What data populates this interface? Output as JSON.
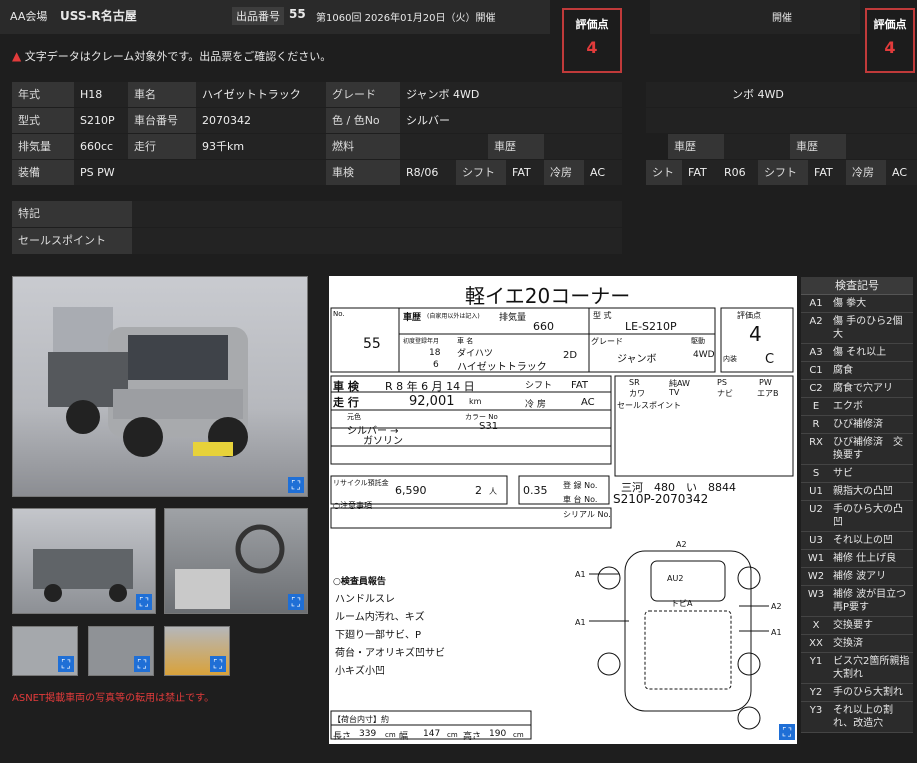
{
  "header": {
    "venue_label": "AA会場",
    "venue": "USS-R名古屋",
    "lot_label": "出品番号",
    "lot": "55",
    "session": "第1060回 2026年01月20日（火）開催",
    "notice": "文字データはクレーム対象外です。出品票をご確認ください。",
    "score_title": "評価点",
    "score": "4",
    "ghost_session": "開催",
    "ghost_score_title": "評価点",
    "ghost_score": "4"
  },
  "specs": {
    "r1": [
      "年式",
      "H18",
      "車名",
      "ハイゼットトラック",
      "グレード",
      "ジャンボ 4WD"
    ],
    "r2": [
      "型式",
      "S210P",
      "車台番号",
      "2070342",
      "色 / 色No",
      "シルバー"
    ],
    "r3": [
      "排気量",
      "660cc",
      "走行",
      "93千km",
      "燃料",
      "",
      "車歴",
      ""
    ],
    "r4": [
      "装備",
      "PS PW",
      "車検",
      "R8/06",
      "シフト",
      "FAT",
      "冷房",
      "AC"
    ],
    "special_label": "特記",
    "sales_label": "セールスポイント",
    "ghost_grade": "ンボ 4WD",
    "ghost_history1": "車歴",
    "ghost_history2": "車歴",
    "ghost_r4": [
      "シト",
      "FAT",
      "R06",
      "シフト",
      "FAT",
      "冷房",
      "AC"
    ]
  },
  "photos": {
    "warning": "ASNET掲載車両の写真等の転用は禁止です。",
    "zoom_icon": "⛶"
  },
  "sheet": {
    "title": "軽イエ20コーナー",
    "no_label": "No.",
    "lot": "55",
    "history_label": "車歴",
    "history_note": "(自家用以外は記入)",
    "displacement_label": "排気量",
    "displacement": "660",
    "model_label": "型 式",
    "model": "LE-S210P",
    "score_label": "評価点",
    "score": "4",
    "first_reg_label": "初度登録年月",
    "year": "18",
    "month": "6",
    "car_name_label": "車 名",
    "maker": "ダイハツ",
    "car_name": "ハイゼットトラック",
    "doors": "2D",
    "grade_label": "グレード",
    "grade": "ジャンボ",
    "drive_label": "駆動",
    "drive": "4WD",
    "interior_label": "内装",
    "interior_score": "C",
    "inspection_label": "車 検",
    "inspection": "R 8 年 6 月 14 日",
    "shift_label": "シフト",
    "shift": "FAT",
    "mileage_label": "走 行",
    "mileage": "92,001",
    "mileage_unit": "km",
    "ac_label": "冷 房",
    "ac": "AC",
    "color_label": "元色",
    "color": "シルバー →",
    "color_no_label": "カラー No",
    "color_no": "S31",
    "fuel": "ガソリン",
    "equip": [
      "SR",
      "純AW",
      "PS",
      "PW",
      "カワ",
      "TV",
      "ナビ",
      "エアB"
    ],
    "sales_point_label": "セールスポイント",
    "recycle_label": "リサイクル預託金",
    "recycle": "6,590",
    "capacity": "2",
    "capacity_unit": "人",
    "load": "0.35",
    "plate_label": "登 録 No.",
    "plate": "三河　480　い　8844",
    "chassis_label": "車 台 No.",
    "chassis": "S210P-2070342",
    "serial_label": "シリアル No.",
    "caution": "○注意事項",
    "inspector_title": "○検査員報告",
    "inspector_notes": [
      "ハンドルスレ",
      "ルーム内汚れ、キズ",
      "下廻り一部サビ、P",
      "荷台・アオリキズ凹サビ",
      "小キズ小凹"
    ],
    "marks": {
      "a2_top": "A2",
      "au2": "AU2",
      "tobia": "トビA",
      "a1_left": "A1",
      "a1_mid": "A1",
      "a2_right": "A2",
      "a1_right": "A1"
    },
    "cargo_label": "【荷台内寸】約",
    "length_label": "長さ",
    "length": "339",
    "width_label": "幅",
    "width": "147",
    "height_label": "高さ",
    "height": "190",
    "unit": "cm"
  },
  "legend": {
    "title": "検査記号",
    "items": [
      {
        "code": "A1",
        "desc": "傷 拳大"
      },
      {
        "code": "A2",
        "desc": "傷 手のひら2個大"
      },
      {
        "code": "A3",
        "desc": "傷 それ以上"
      },
      {
        "code": "C1",
        "desc": "腐食"
      },
      {
        "code": "C2",
        "desc": "腐食で穴アリ"
      },
      {
        "code": "E",
        "desc": "エクボ"
      },
      {
        "code": "R",
        "desc": "ひび補修済"
      },
      {
        "code": "RX",
        "desc": "ひび補修済　交換要す"
      },
      {
        "code": "S",
        "desc": "サビ"
      },
      {
        "code": "U1",
        "desc": "親指大の凸凹"
      },
      {
        "code": "U2",
        "desc": "手のひら大の凸凹"
      },
      {
        "code": "U3",
        "desc": "それ以上の凹"
      },
      {
        "code": "W1",
        "desc": "補修 仕上げ良"
      },
      {
        "code": "W2",
        "desc": "補修 波アリ"
      },
      {
        "code": "W3",
        "desc": "補修 波が目立つ　再P要す"
      },
      {
        "code": "X",
        "desc": "交換要す"
      },
      {
        "code": "XX",
        "desc": "交換済"
      },
      {
        "code": "Y1",
        "desc": "ビス穴2箇所親指大割れ"
      },
      {
        "code": "Y2",
        "desc": "手のひら大割れ"
      },
      {
        "code": "Y3",
        "desc": "それ以上の割れ、改造穴"
      }
    ]
  },
  "colors": {
    "accent_red": "#e23b3b",
    "zoom_blue": "#1f6fd6"
  }
}
